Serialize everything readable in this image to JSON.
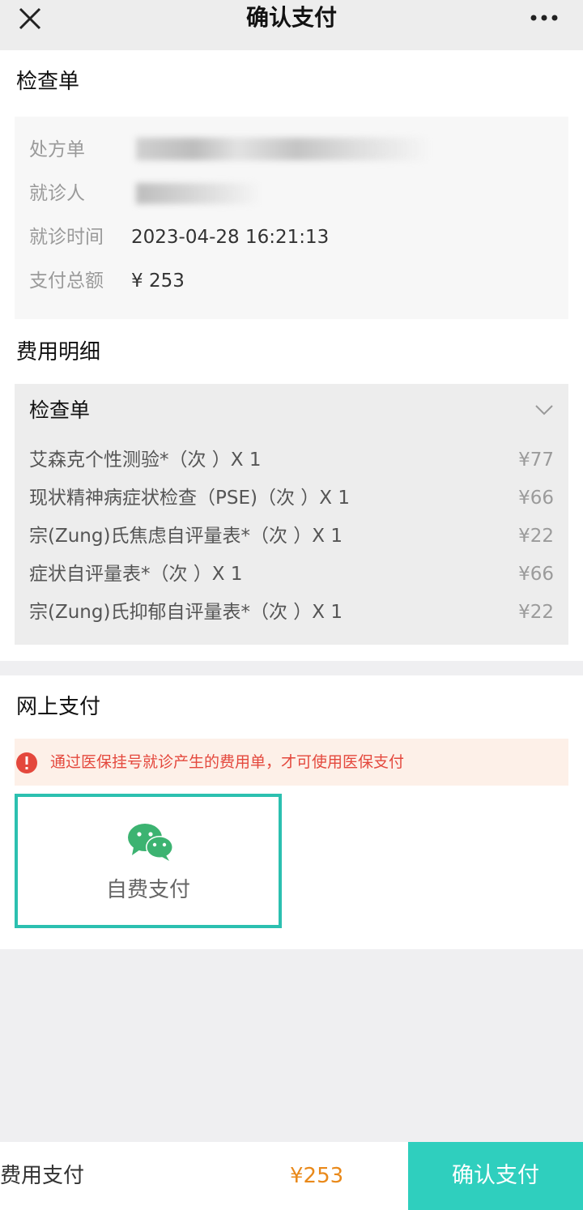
{
  "header": {
    "title": "确认支付"
  },
  "exam_section": {
    "title": "检查单",
    "info": [
      {
        "label": "处方单",
        "value": ""
      },
      {
        "label": "就诊人",
        "value": ""
      },
      {
        "label": "就诊时间",
        "value": "2023-04-28 16:21:13"
      },
      {
        "label": "支付总额",
        "value": "¥ 253"
      }
    ]
  },
  "fee_detail": {
    "title": "费用明细",
    "card_title": "检查单",
    "items": [
      {
        "name": "艾森克个性测验*（次 ）X 1",
        "price": "¥77"
      },
      {
        "name": "现状精神病症状检查（PSE)（次 ）X 1",
        "price": "¥66"
      },
      {
        "name": "宗(Zung)氏焦虑自评量表*（次 ）X 1",
        "price": "¥22"
      },
      {
        "name": "症状自评量表*（次 ）X 1",
        "price": "¥66"
      },
      {
        "name": "宗(Zung)氏抑郁自评量表*（次 ）X 1",
        "price": "¥22"
      }
    ]
  },
  "online_pay": {
    "title": "网上支付",
    "warning": "通过医保挂号就诊产生的费用单，才可使用医保支付",
    "option_label": "自费支付"
  },
  "footer": {
    "fee_label": "费用支付",
    "amount": "¥253",
    "confirm_label": "确认支付"
  },
  "colors": {
    "accent": "#2fcfbe",
    "price_orange": "#e9891a",
    "warning_red": "#e4483d",
    "wechat_green": "#3cb371"
  },
  "icons": [
    "close-icon",
    "more-icon",
    "chevron-down-icon",
    "alert-icon",
    "wechat-icon"
  ]
}
